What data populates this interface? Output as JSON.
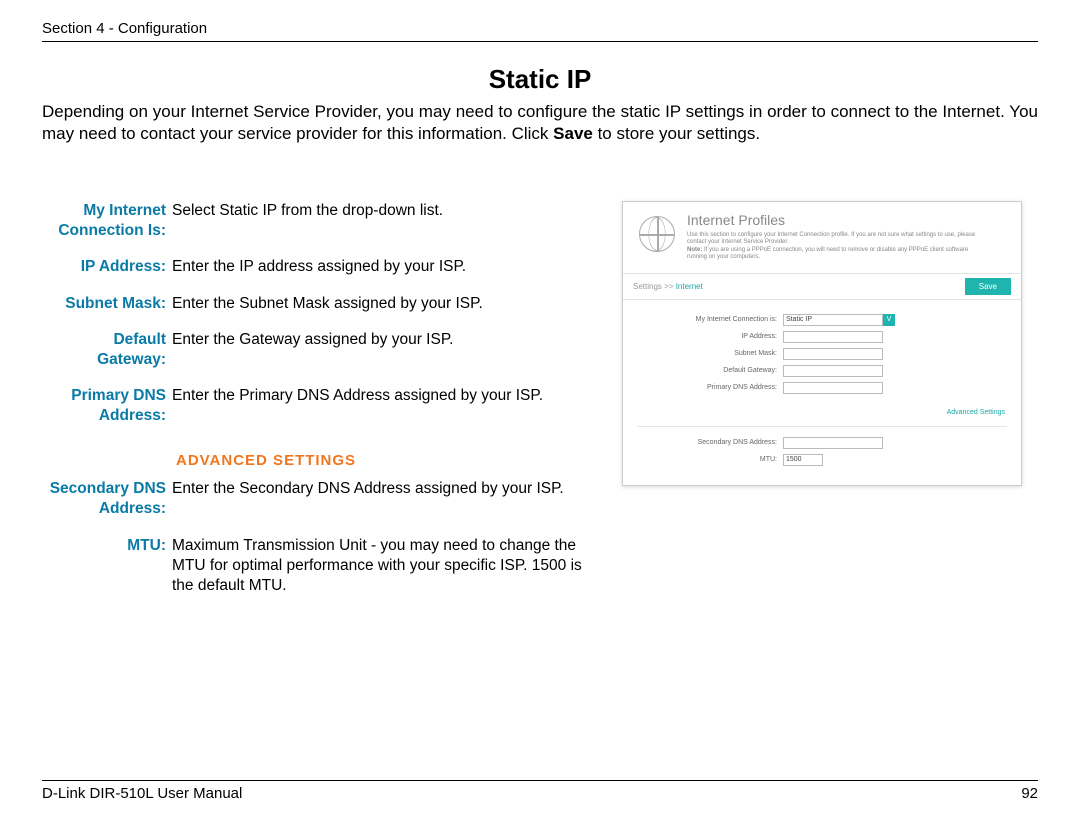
{
  "header": {
    "section": "Section 4 - Configuration"
  },
  "title": "Static IP",
  "intro": {
    "part1": "Depending on your Internet Service Provider, you may need to configure the static IP settings in order to connect to the Internet. You may need to contact your service provider for this information. Click ",
    "bold": "Save",
    "part2": " to store your settings."
  },
  "definitions": {
    "rows1": [
      {
        "label": "My Internet Connection Is:",
        "value": "Select Static IP from the drop-down list."
      },
      {
        "label": "IP Address:",
        "value": "Enter the IP address assigned by your ISP."
      },
      {
        "label": "Subnet Mask:",
        "value": "Enter the Subnet Mask assigned by your ISP."
      },
      {
        "label": "Default Gateway:",
        "value": "Enter the Gateway assigned by your ISP."
      },
      {
        "label": "Primary DNS Address:",
        "value": "Enter the Primary DNS Address assigned by your ISP."
      }
    ],
    "advanced_heading": "ADVANCED SETTINGS",
    "rows2": [
      {
        "label": "Secondary DNS Address:",
        "value": "Enter the Secondary DNS Address assigned by your ISP."
      },
      {
        "label": "MTU:",
        "value": "Maximum Transmission Unit - you may need to change the MTU for optimal performance with your specific ISP. 1500 is the default MTU."
      }
    ]
  },
  "screenshot": {
    "title": "Internet Profiles",
    "desc_line1": "Use this section to configure your Internet Connection profile. If you are not sure what settings to use, please contact your Internet Service Provider.",
    "desc_note_label": "Note:",
    "desc_note": " If you are using a PPPoE connection, you will need to remove or disable any PPPoE client software running on your computers.",
    "breadcrumb_a": "Settings",
    "breadcrumb_sep": " >> ",
    "breadcrumb_b": "Internet",
    "save": "Save",
    "fields1": [
      {
        "label": "My Internet Connection is:",
        "value": "Static IP",
        "type": "dropdown"
      },
      {
        "label": "IP Address:",
        "value": "",
        "type": "text"
      },
      {
        "label": "Subnet Mask:",
        "value": "",
        "type": "text"
      },
      {
        "label": "Default Gateway:",
        "value": "",
        "type": "text"
      },
      {
        "label": "Primary DNS Address:",
        "value": "",
        "type": "text"
      }
    ],
    "advanced_link": "Advanced Settings",
    "fields2": [
      {
        "label": "Secondary DNS Address:",
        "value": "",
        "type": "text"
      },
      {
        "label": "MTU:",
        "value": "1500",
        "type": "small"
      }
    ]
  },
  "footer": {
    "left": "D-Link DIR-510L User Manual",
    "right": "92"
  }
}
